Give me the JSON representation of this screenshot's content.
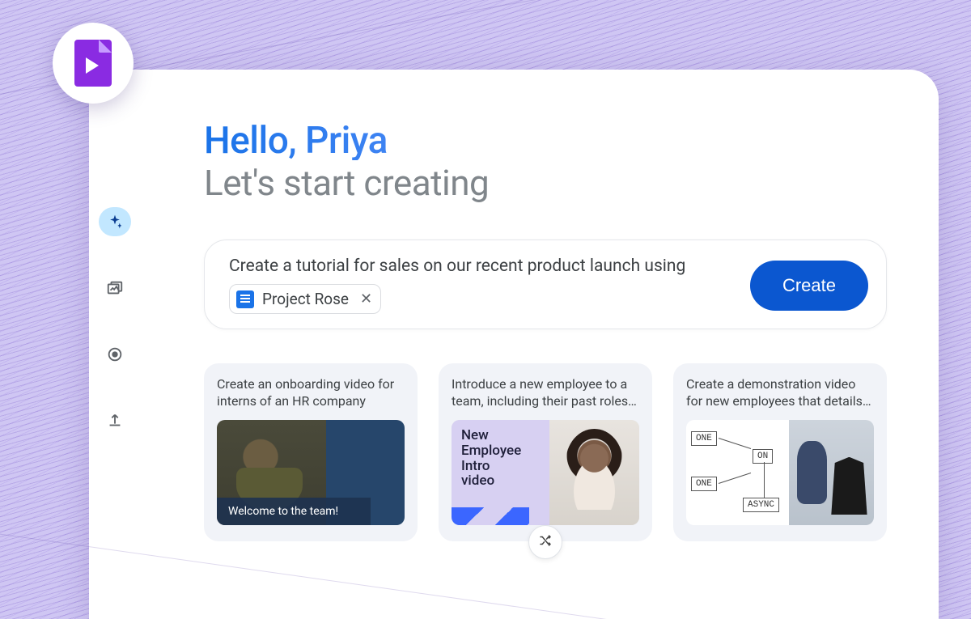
{
  "app": {
    "name": "Google Vids"
  },
  "header": {
    "greeting": "Hello, Priya",
    "subtitle": "Let's start creating"
  },
  "prompt": {
    "text": "Create a tutorial for sales on our recent product launch using",
    "chip": {
      "label": "Project Rose",
      "icon": "google-doc-icon"
    },
    "create_label": "Create"
  },
  "sidebar": {
    "items": [
      {
        "name": "ai-home",
        "icon": "sparkle-icon",
        "active": true
      },
      {
        "name": "templates",
        "icon": "gallery-icon",
        "active": false
      },
      {
        "name": "record",
        "icon": "record-icon",
        "active": false
      },
      {
        "name": "upload",
        "icon": "upload-icon",
        "active": false
      }
    ]
  },
  "suggestions": [
    {
      "title": "Create an onboarding video for interns of an HR company",
      "caption": "Welcome to the team!"
    },
    {
      "title": "Introduce a new employee to a team, including their past roles…",
      "overlay": "New\nEmployee\nIntro\nvideo"
    },
    {
      "title": "Create a demonstration video for new employees that details…",
      "nodes": [
        "ONE",
        "ON",
        "ONE",
        "ASYNC"
      ]
    }
  ],
  "shuffle_label": "Shuffle suggestions",
  "colors": {
    "primary": "#0b57d0",
    "accent_light": "#c2e7ff",
    "brand_purple": "#8a2be2"
  }
}
